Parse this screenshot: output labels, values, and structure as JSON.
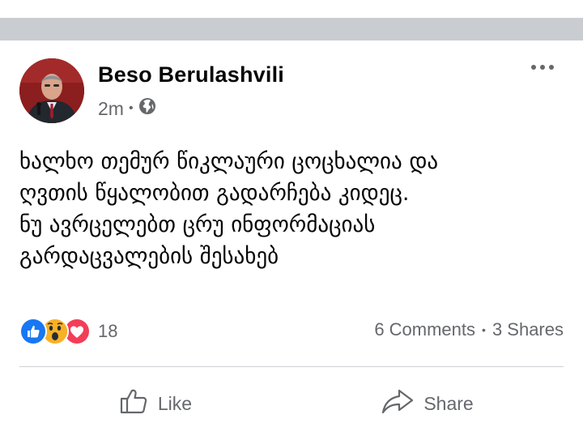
{
  "post": {
    "author": "Beso Berulashvili",
    "time": "2m",
    "separator_dot": "•",
    "privacy_icon": "globe-icon",
    "more_icon": "more-horizontal-icon",
    "text_lines": [
      "ხალხო თემურ წიკლაური ცოცხალია და",
      "ღვთის წყალობით გადარჩება კიდეც.",
      "ნუ ავრცელებთ ცრუ ინფორმაციას",
      "გარდაცვალების შესახებ"
    ]
  },
  "stats": {
    "reactions": [
      "like",
      "wow",
      "love"
    ],
    "reaction_count": "18",
    "comments": "6 Comments",
    "dot": "•",
    "shares": "3 Shares"
  },
  "actions": {
    "like_label": "Like",
    "share_label": "Share"
  },
  "colors": {
    "like_blue": "#1877f2",
    "love_red": "#f33e58",
    "wow_yellow": "#f7b125",
    "secondary_text": "#65676b",
    "separator_gray": "#c9ccd1"
  }
}
